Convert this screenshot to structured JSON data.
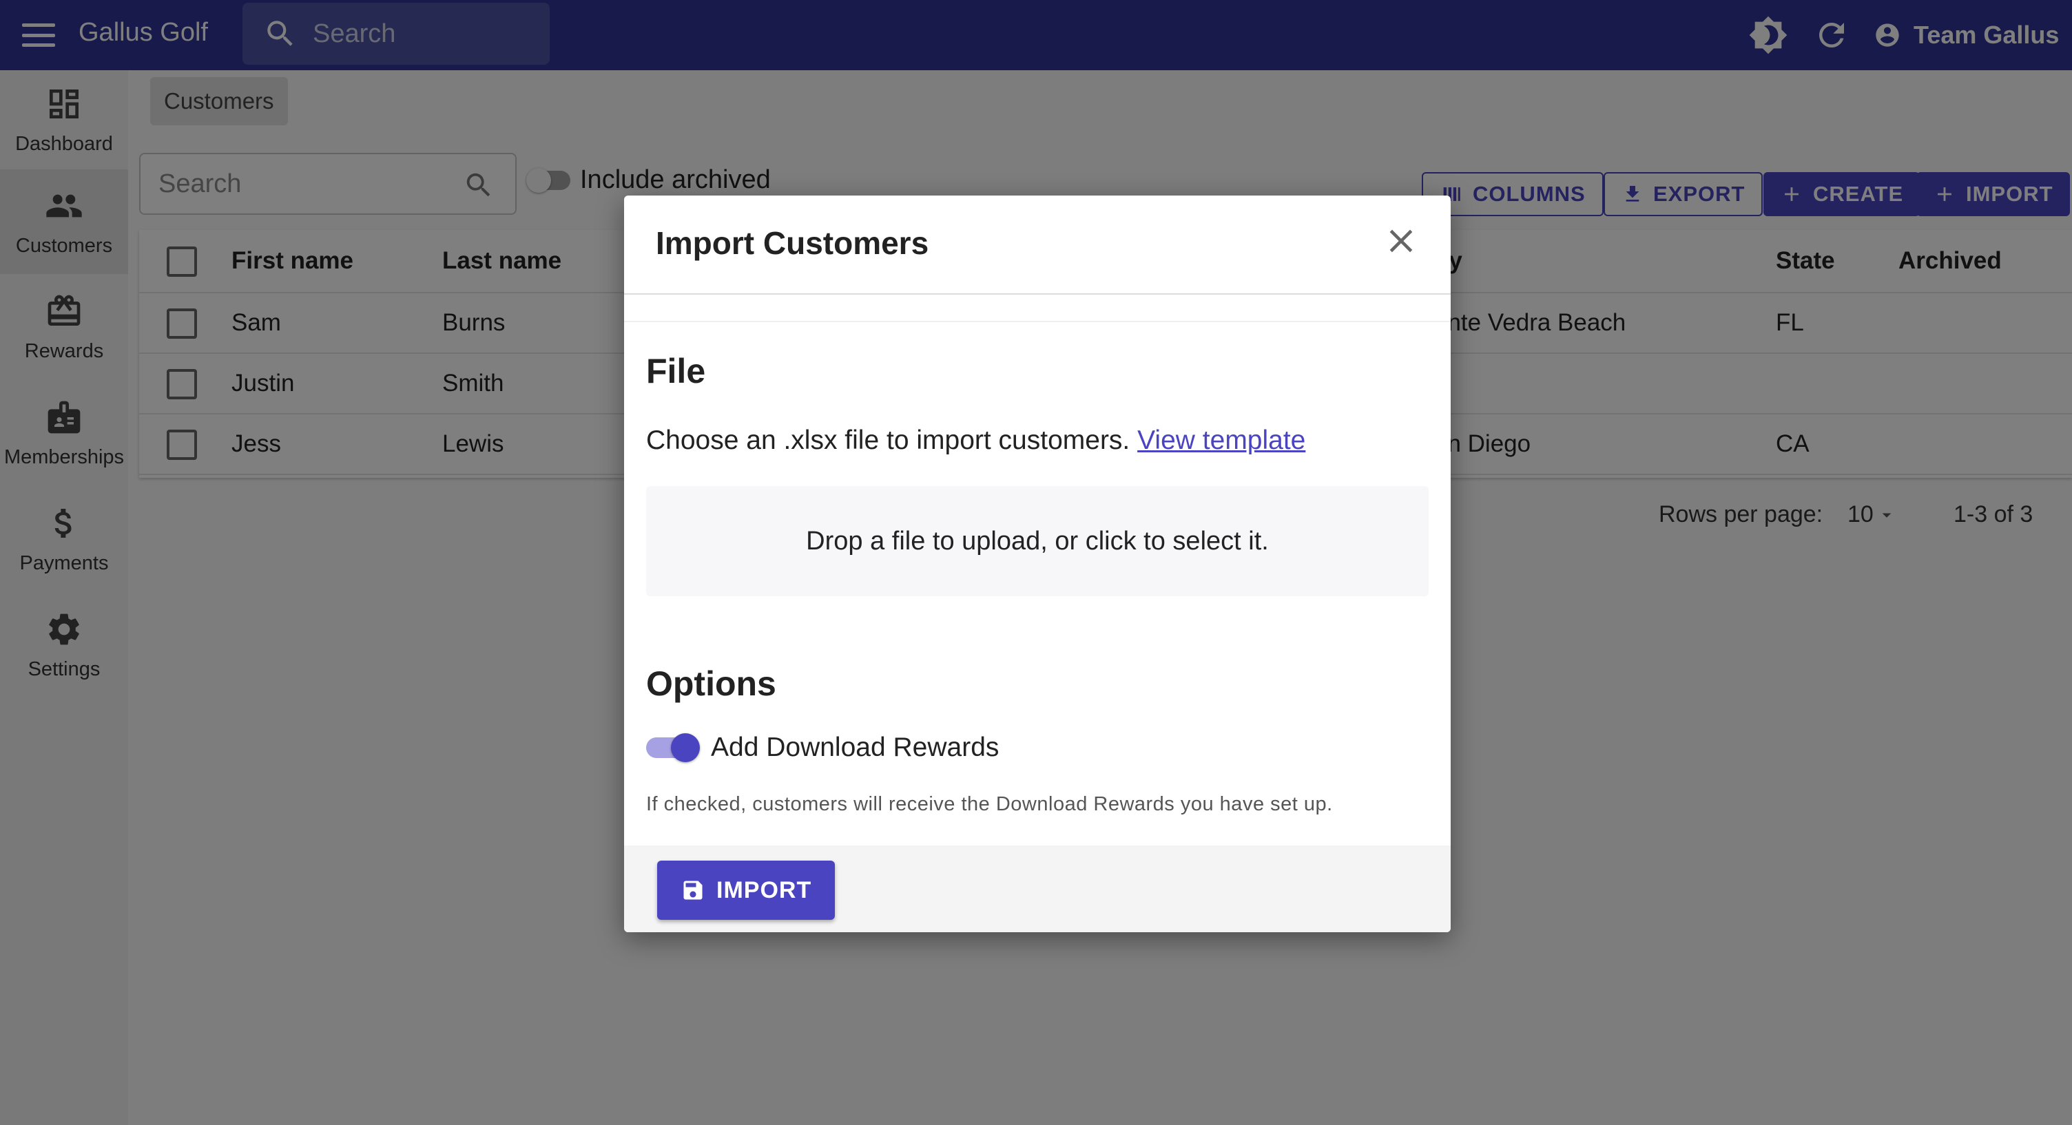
{
  "appbar": {
    "title": "Gallus Golf",
    "search_placeholder": "Search",
    "user_name": "Team Gallus"
  },
  "sidebar": {
    "items": [
      {
        "label": "Dashboard",
        "icon": "dashboard-icon"
      },
      {
        "label": "Customers",
        "icon": "people-icon",
        "active": true
      },
      {
        "label": "Rewards",
        "icon": "gift-card-icon"
      },
      {
        "label": "Memberships",
        "icon": "badge-icon"
      },
      {
        "label": "Payments",
        "icon": "dollar-icon"
      },
      {
        "label": "Settings",
        "icon": "gear-icon"
      }
    ]
  },
  "breadcrumb": "Customers",
  "list": {
    "search_placeholder": "Search",
    "include_archived_label": "Include archived",
    "include_archived": false,
    "toolbar": {
      "columns_label": "COLUMNS",
      "export_label": "EXPORT",
      "create_label": "CREATE",
      "import_label": "IMPORT"
    },
    "columns": [
      "First name",
      "Last name",
      "ity",
      "State",
      "Archived"
    ],
    "rows": [
      {
        "first": "Sam",
        "last": "Burns",
        "city": "onte Vedra Beach",
        "state": "FL",
        "archived": ""
      },
      {
        "first": "Justin",
        "last": "Smith",
        "city": "",
        "state": "",
        "archived": ""
      },
      {
        "first": "Jess",
        "last": "Lewis",
        "city": "an Diego",
        "state": "CA",
        "archived": ""
      }
    ],
    "pagination": {
      "rows_per_page_label": "Rows per page:",
      "rows_per_page": "10",
      "range": "1-3 of 3"
    }
  },
  "modal": {
    "title": "Import Customers",
    "file_heading": "File",
    "file_description": "Choose an .xlsx file to import customers.",
    "template_link": "View template",
    "dropzone_text": "Drop a file to upload, or click to select it.",
    "options_heading": "Options",
    "option_label": "Add Download Rewards",
    "option_enabled": true,
    "option_helper": "If checked, customers will receive the Download Rewards you have set up.",
    "import_button": "IMPORT"
  },
  "colors": {
    "appbar": "#2e3494",
    "primary": "#4b44c0",
    "sidebar": "#f2f2f2"
  }
}
